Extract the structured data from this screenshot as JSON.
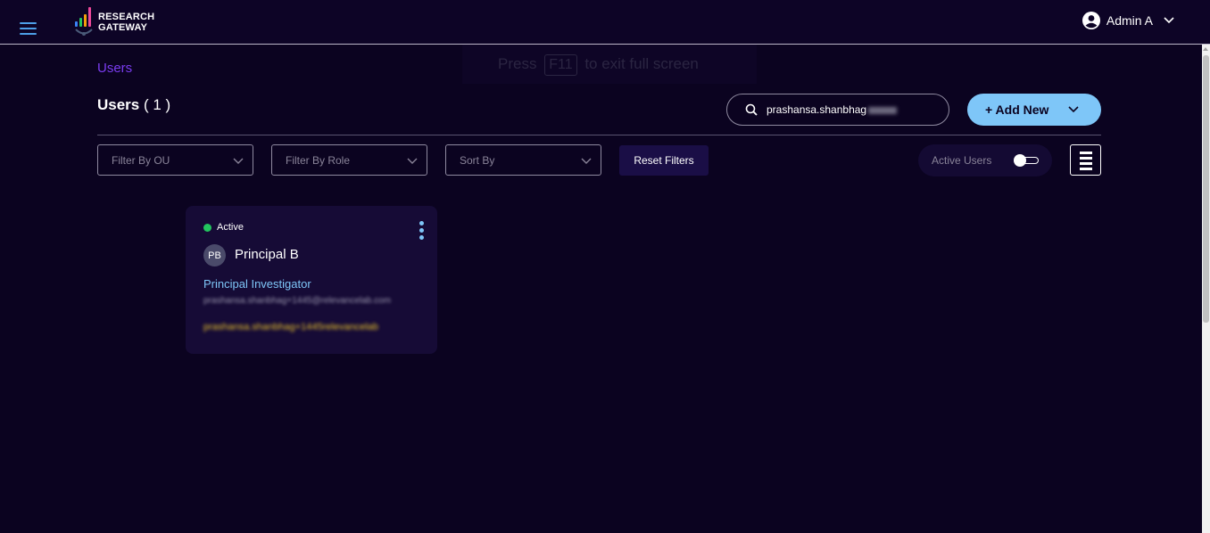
{
  "header": {
    "logo_line1": "RESEARCH",
    "logo_line2": "GATEWAY",
    "user_name": "Admin A",
    "logo_colors": [
      "#3b82f6",
      "#22c55e",
      "#f59e0b",
      "#ec4899"
    ]
  },
  "fullscreen_hint": {
    "prefix": "Press",
    "key": "F11",
    "suffix": "to exit full screen"
  },
  "breadcrumb": "Users",
  "page": {
    "title": "Users",
    "count": "( 1 )"
  },
  "search": {
    "value": "prashansa.shanbhag"
  },
  "actions": {
    "add_new": "+ Add New"
  },
  "filters": {
    "ou": "Filter By OU",
    "role": "Filter By Role",
    "sort": "Sort By",
    "reset": "Reset Filters",
    "active_users": "Active Users"
  },
  "users": [
    {
      "status": "Active",
      "initials": "PB",
      "name": "Principal B",
      "role": "Principal Investigator",
      "email": "prashansa.shanbhag+1445@relevancelab.com",
      "username": "prashansa.shanbhag+1445relevancelab"
    }
  ],
  "colors": {
    "background": "#0b0320",
    "accent": "#7ec6f8",
    "breadcrumb": "#7a3cf0",
    "active": "#22c55e",
    "username": "#e7c12e"
  }
}
